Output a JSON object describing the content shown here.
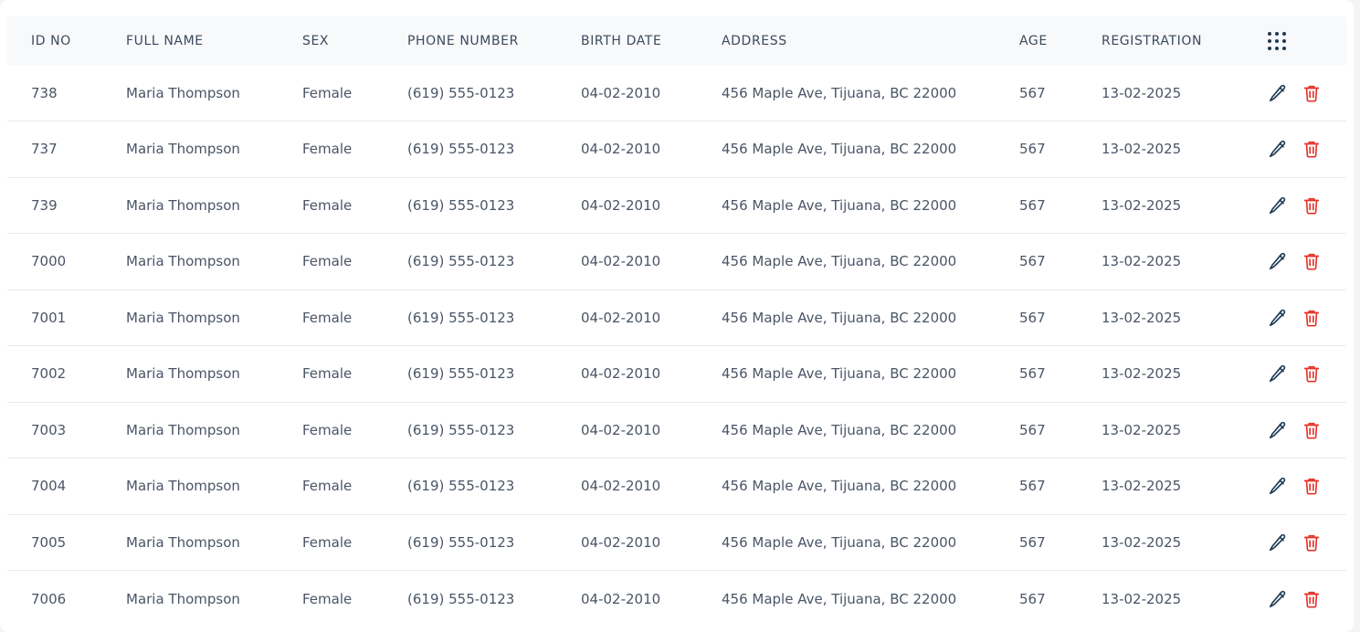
{
  "colors": {
    "edit_icon": "#1f3a52",
    "delete_icon": "#e5332a",
    "grid_icon": "#1f3a52",
    "header_bg": "#f8f9fb",
    "text": "#4a5566"
  },
  "table": {
    "headers": [
      "ID NO",
      "FULL NAME",
      "SEX",
      "PHONE NUMBER",
      "BIRTH DATE",
      "ADDRESS",
      "AGE",
      "REGISTRATION"
    ],
    "column_settings_icon": "dots-grid-icon",
    "row_action_icons": [
      "pencil-edit-icon",
      "trash-delete-icon"
    ],
    "rows": [
      {
        "id": "738",
        "name": "Maria Thompson",
        "sex": "Female",
        "phone": "(619) 555-0123",
        "birth": "04-02-2010",
        "address": "456 Maple Ave, Tijuana, BC 22000",
        "age": "567",
        "registration": "13-02-2025"
      },
      {
        "id": "737",
        "name": "Maria Thompson",
        "sex": "Female",
        "phone": "(619) 555-0123",
        "birth": "04-02-2010",
        "address": "456 Maple Ave, Tijuana, BC 22000",
        "age": "567",
        "registration": "13-02-2025"
      },
      {
        "id": "739",
        "name": "Maria Thompson",
        "sex": "Female",
        "phone": "(619) 555-0123",
        "birth": "04-02-2010",
        "address": "456 Maple Ave, Tijuana, BC 22000",
        "age": "567",
        "registration": "13-02-2025"
      },
      {
        "id": "7000",
        "name": "Maria Thompson",
        "sex": "Female",
        "phone": "(619) 555-0123",
        "birth": "04-02-2010",
        "address": "456 Maple Ave, Tijuana, BC 22000",
        "age": "567",
        "registration": "13-02-2025"
      },
      {
        "id": "7001",
        "name": "Maria Thompson",
        "sex": "Female",
        "phone": "(619) 555-0123",
        "birth": "04-02-2010",
        "address": "456 Maple Ave, Tijuana, BC 22000",
        "age": "567",
        "registration": "13-02-2025"
      },
      {
        "id": "7002",
        "name": "Maria Thompson",
        "sex": "Female",
        "phone": "(619) 555-0123",
        "birth": "04-02-2010",
        "address": "456 Maple Ave, Tijuana, BC 22000",
        "age": "567",
        "registration": "13-02-2025"
      },
      {
        "id": "7003",
        "name": "Maria Thompson",
        "sex": "Female",
        "phone": "(619) 555-0123",
        "birth": "04-02-2010",
        "address": "456 Maple Ave, Tijuana, BC 22000",
        "age": "567",
        "registration": "13-02-2025"
      },
      {
        "id": "7004",
        "name": "Maria Thompson",
        "sex": "Female",
        "phone": "(619) 555-0123",
        "birth": "04-02-2010",
        "address": "456 Maple Ave, Tijuana, BC 22000",
        "age": "567",
        "registration": "13-02-2025"
      },
      {
        "id": "7005",
        "name": "Maria Thompson",
        "sex": "Female",
        "phone": "(619) 555-0123",
        "birth": "04-02-2010",
        "address": "456 Maple Ave, Tijuana, BC 22000",
        "age": "567",
        "registration": "13-02-2025"
      },
      {
        "id": "7006",
        "name": "Maria Thompson",
        "sex": "Female",
        "phone": "(619) 555-0123",
        "birth": "04-02-2010",
        "address": "456 Maple Ave, Tijuana, BC 22000",
        "age": "567",
        "registration": "13-02-2025"
      }
    ]
  }
}
